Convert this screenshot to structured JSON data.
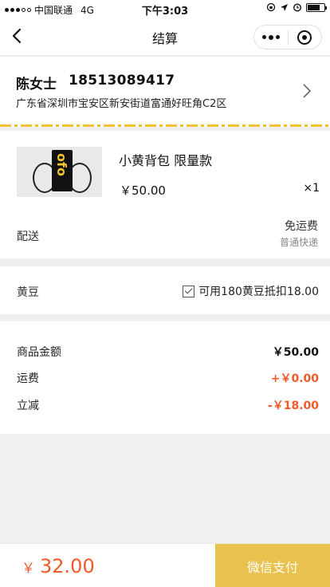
{
  "status_bar": {
    "carrier": "中国联通",
    "network": "4G",
    "time": "下午3:03"
  },
  "nav": {
    "title": "结算",
    "icons": [
      "back-icon",
      "more-icon",
      "close-mini-program-icon"
    ]
  },
  "address": {
    "name": "陈女士",
    "phone": "18513089417",
    "detail": "广东省深圳市宝安区新安街道富通好旺角C2区"
  },
  "product": {
    "image_text": "ofo",
    "name": "小黄背包 限量款",
    "price": "￥50.00",
    "quantity": "×1"
  },
  "shipping": {
    "label": "配送",
    "fee": "免运费",
    "method": "普通快递"
  },
  "beans": {
    "label": "黄豆",
    "option": "可用180黄豆抵扣18.00",
    "checked": true
  },
  "summary": {
    "rows": [
      {
        "label": "商品金额",
        "value": "￥50.00",
        "color": "#111111"
      },
      {
        "label": "运费",
        "value": "+￥0.00",
        "color": "#f05a2a"
      },
      {
        "label": "立减",
        "value": "-￥18.00",
        "color": "#f05a2a"
      }
    ]
  },
  "footer": {
    "currency": "￥",
    "total": "32.00",
    "pay_label": "微信支付"
  },
  "colors": {
    "accent_red": "#f05a2a",
    "pay_button": "#e9c14d",
    "stripe": "#f2c230"
  }
}
